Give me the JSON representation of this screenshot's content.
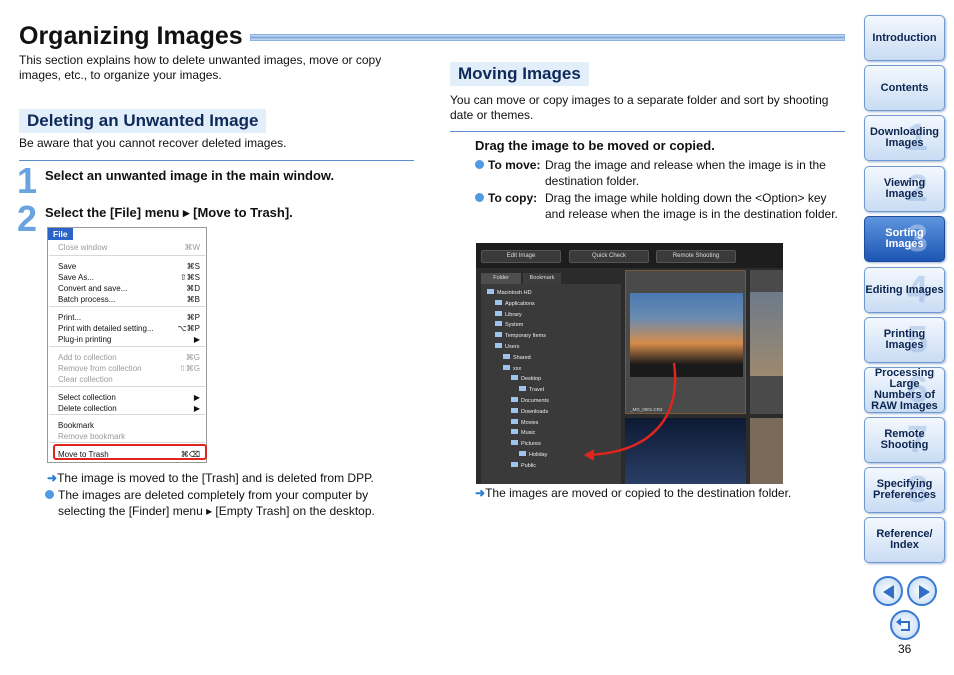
{
  "title": "Organizing Images",
  "intro": "This section explains how to delete unwanted images, move or copy images, etc., to organize your images.",
  "delete": {
    "heading": "Deleting an Unwanted Image",
    "note": "Be aware that you cannot recover deleted images.",
    "step1_num": "1",
    "step1": "Select an unwanted image in the main window.",
    "step2_num": "2",
    "step2": "Select the [File] menu ▸ [Move to Trash].",
    "result1": "The image is moved to the [Trash] and is deleted from DPP.",
    "result2": "The images are deleted completely from your computer by selecting the [Finder] menu ▸ [Empty Trash] on the desktop."
  },
  "menu": {
    "title": "File",
    "items": [
      {
        "label": "Close window",
        "sc": "⌘W",
        "dim": true
      },
      {
        "label": "Save",
        "sc": "⌘S",
        "dim": false
      },
      {
        "label": "Save As...",
        "sc": "⇧⌘S",
        "dim": false
      },
      {
        "label": "Convert and save...",
        "sc": "⌘D",
        "dim": false
      },
      {
        "label": "Batch process...",
        "sc": "⌘B",
        "dim": false
      },
      {
        "label": "Print...",
        "sc": "⌘P",
        "dim": false
      },
      {
        "label": "Print with detailed setting...",
        "sc": "⌥⌘P",
        "dim": false
      },
      {
        "label": "Plug-in printing",
        "sc": "▶",
        "dim": false
      },
      {
        "label": "Add to collection",
        "sc": "⌘G",
        "dim": true
      },
      {
        "label": "Remove from collection",
        "sc": "⇧⌘G",
        "dim": true
      },
      {
        "label": "Clear collection",
        "sc": "",
        "dim": true
      },
      {
        "label": "Select collection",
        "sc": "▶",
        "dim": false
      },
      {
        "label": "Delete collection",
        "sc": "▶",
        "dim": false
      },
      {
        "label": "Bookmark",
        "sc": "",
        "dim": false
      },
      {
        "label": "Remove bookmark",
        "sc": "",
        "dim": true
      },
      {
        "label": "Move to Trash",
        "sc": "⌘⌫",
        "dim": false
      }
    ]
  },
  "move": {
    "heading": "Moving Images",
    "intro": "You can move or copy images to a separate folder and sort by shooting date or themes.",
    "drag_head": "Drag the image to be moved or copied.",
    "to_move_label": "To move:",
    "to_move": "Drag the image and release when the image is in the destination folder.",
    "to_copy_label": "To copy:",
    "to_copy": "Drag the image while holding down the <Option> key and release when the image is in the destination folder.",
    "result": "The images are moved or copied to the destination folder."
  },
  "shot": {
    "buttons": [
      "Edit Image",
      "Quick Check",
      "Remote Shooting"
    ],
    "tabs": [
      "Folder",
      "Bookmark"
    ],
    "tree": [
      {
        "label": "Macintosh HD",
        "indent": 0
      },
      {
        "label": "Applications",
        "indent": 1
      },
      {
        "label": "Library",
        "indent": 1
      },
      {
        "label": "System",
        "indent": 1
      },
      {
        "label": "Temporary Items",
        "indent": 1
      },
      {
        "label": "Users",
        "indent": 1
      },
      {
        "label": "Shared",
        "indent": 2
      },
      {
        "label": "xxx",
        "indent": 2
      },
      {
        "label": "Desktop",
        "indent": 3
      },
      {
        "label": "Travel",
        "indent": 4
      },
      {
        "label": "Documents",
        "indent": 3
      },
      {
        "label": "Downloads",
        "indent": 3
      },
      {
        "label": "Movies",
        "indent": 3
      },
      {
        "label": "Music",
        "indent": 3
      },
      {
        "label": "Pictures",
        "indent": 3
      },
      {
        "label": "Holiday",
        "indent": 4
      },
      {
        "label": "Public",
        "indent": 3
      }
    ],
    "thumb_caption": "_MG_0001.CR2"
  },
  "nav": [
    {
      "label": "Introduction",
      "num": "",
      "active": false
    },
    {
      "label": "Contents",
      "num": "",
      "active": false
    },
    {
      "label": "Downloading Images",
      "num": "1",
      "active": false
    },
    {
      "label": "Viewing Images",
      "num": "2",
      "active": false
    },
    {
      "label": "Sorting Images",
      "num": "3",
      "active": true
    },
    {
      "label": "Editing Images",
      "num": "4",
      "active": false
    },
    {
      "label": "Printing Images",
      "num": "5",
      "active": false
    },
    {
      "label": "Processing Large Numbers of RAW Images",
      "num": "6",
      "active": false
    },
    {
      "label": "Remote Shooting",
      "num": "7",
      "active": false
    },
    {
      "label": "Specifying Preferences",
      "num": "8",
      "active": false
    },
    {
      "label": "Reference/ Index",
      "num": "",
      "active": false
    }
  ],
  "page_number": "36",
  "colors": {
    "accent": "#2f6fc7",
    "highlight": "#e0241e"
  }
}
